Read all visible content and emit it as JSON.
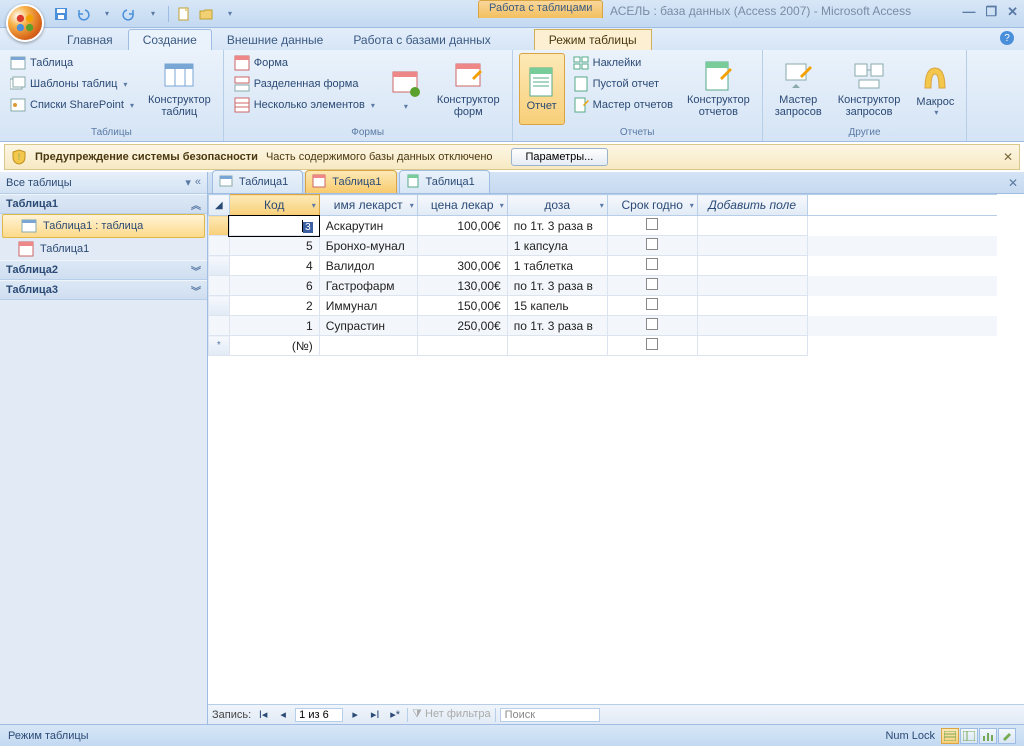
{
  "title": "АСЕЛЬ : база данных (Access 2007) - Microsoft Access",
  "context_tab": "Работа с таблицами",
  "tabs": {
    "home": "Главная",
    "create": "Создание",
    "external": "Внешние данные",
    "db_tools": "Работа с базами данных",
    "datasheet": "Режим таблицы"
  },
  "ribbon": {
    "tables": {
      "title": "Таблицы",
      "table": "Таблица",
      "templates": "Шаблоны таблиц",
      "sharepoint": "Списки SharePoint",
      "designer": "Конструктор\nтаблиц"
    },
    "forms": {
      "title": "Формы",
      "form": "Форма",
      "split": "Разделенная форма",
      "multi": "Несколько элементов",
      "designer": "Конструктор\nформ"
    },
    "reports": {
      "title": "Отчеты",
      "report": "Отчет",
      "labels": "Наклейки",
      "blank": "Пустой отчет",
      "wizard": "Мастер отчетов",
      "designer": "Конструктор\nотчетов"
    },
    "other": {
      "title": "Другие",
      "query_wiz": "Мастер\nзапросов",
      "query_design": "Конструктор\nзапросов",
      "macro": "Макрос"
    }
  },
  "security": {
    "heading": "Предупреждение системы безопасности",
    "text": "Часть содержимого базы данных отключено",
    "button": "Параметры..."
  },
  "nav": {
    "header": "Все таблицы",
    "group1": "Таблица1",
    "item1": "Таблица1 : таблица",
    "item2": "Таблица1",
    "group2": "Таблица2",
    "group3": "Таблица3"
  },
  "doc_tabs": {
    "t1": "Таблица1",
    "t2": "Таблица1",
    "t3": "Таблица1"
  },
  "columns": {
    "c0": "Код",
    "c1": "имя лекарст",
    "c2": "цена лекар",
    "c3": "доза",
    "c4": "Срок годно",
    "add": "Добавить поле"
  },
  "rows": [
    {
      "id": "3",
      "name": "Аскарутин",
      "price": "100,00€",
      "dose": "по 1т. 3 раза в"
    },
    {
      "id": "5",
      "name": "Бронхо-мунал",
      "price": "",
      "dose": "1 капсула"
    },
    {
      "id": "4",
      "name": "Валидол",
      "price": "300,00€",
      "dose": "1 таблетка"
    },
    {
      "id": "6",
      "name": "Гастрофарм",
      "price": "130,00€",
      "dose": "по 1т. 3 раза в"
    },
    {
      "id": "2",
      "name": "Иммунал",
      "price": "150,00€",
      "dose": "15 капель"
    },
    {
      "id": "1",
      "name": "Супрастин",
      "price": "250,00€",
      "dose": "по 1т. 3 раза в"
    }
  ],
  "new_row_id": "(№)",
  "recnav": {
    "label": "Запись:",
    "pos": "1 из 6",
    "filter": "Нет фильтра",
    "search": "Поиск"
  },
  "status": {
    "mode": "Режим таблицы",
    "numlock": "Num Lock"
  }
}
